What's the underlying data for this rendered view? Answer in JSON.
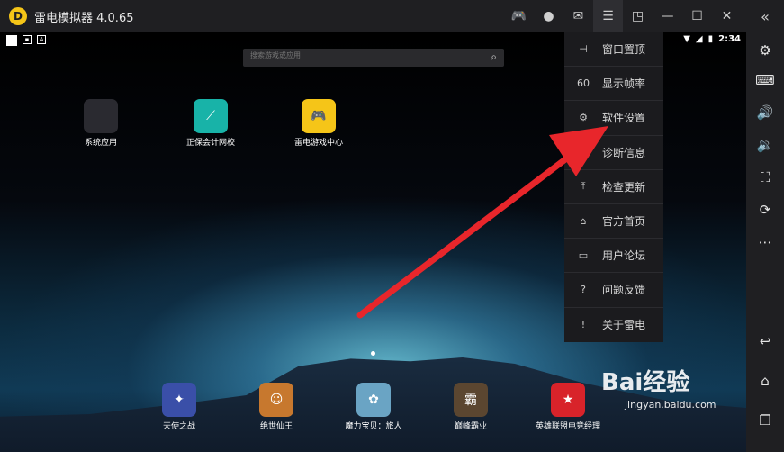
{
  "titlebar": {
    "title": "雷电模拟器 4.0.65",
    "logo_text": "D",
    "icons": [
      "gamepad-icon",
      "user-icon",
      "mail-icon",
      "menu-icon",
      "resize-icon",
      "minimize-icon",
      "maximize-icon",
      "close-icon"
    ],
    "collapse_icon": "«"
  },
  "statusbar": {
    "time": "2:34",
    "left_icons": [
      "square-icon",
      "image-icon",
      "a-icon"
    ],
    "right_icons": [
      "wifi-icon",
      "signal-icon",
      "battery-icon"
    ]
  },
  "search": {
    "placeholder": "搜索游戏或应用"
  },
  "apps_top": [
    {
      "label": "系统应用",
      "icon": "folder-icon",
      "color": "#2a2a30"
    },
    {
      "label": "正保会计网校",
      "icon": "zhengbao-icon",
      "color": "#18b3a8"
    },
    {
      "label": "雷电游戏中心",
      "icon": "game-center-icon",
      "color": "#f5c518"
    }
  ],
  "apps_bottom": [
    {
      "label": "天使之战",
      "icon": "angel-war-icon",
      "color": "#3a4fa8"
    },
    {
      "label": "绝世仙王",
      "icon": "xianwang-icon",
      "color": "#c7782e"
    },
    {
      "label": "魔力宝贝：旅人",
      "icon": "molibaobei-icon",
      "color": "#6aa4c4"
    },
    {
      "label": "巅峰霸业",
      "icon": "dianfeng-icon",
      "color": "#5b4630"
    },
    {
      "label": "英雄联盟电竞经理",
      "icon": "lol-manager-icon",
      "color": "#d8232a"
    }
  ],
  "menu": {
    "items": [
      {
        "label": "窗口置顶",
        "icon": "pin-icon",
        "glyph": "⊣"
      },
      {
        "label": "显示帧率",
        "icon": "fps-icon",
        "glyph": "60"
      },
      {
        "label": "软件设置",
        "icon": "gear-icon",
        "glyph": "⚙"
      },
      {
        "label": "诊断信息",
        "icon": "diagnose-icon",
        "glyph": "⧗"
      },
      {
        "label": "检查更新",
        "icon": "upload-icon",
        "glyph": "⤒"
      },
      {
        "label": "官方首页",
        "icon": "home-icon",
        "glyph": "⌂"
      },
      {
        "label": "用户论坛",
        "icon": "forum-icon",
        "glyph": "▭"
      },
      {
        "label": "问题反馈",
        "icon": "question-icon",
        "glyph": "?"
      },
      {
        "label": "关于雷电",
        "icon": "info-icon",
        "glyph": "!"
      }
    ]
  },
  "sidebar": {
    "buttons": [
      {
        "name": "settings-gear",
        "glyph": "⚙"
      },
      {
        "name": "keyboard",
        "glyph": "⌨"
      },
      {
        "name": "volume-up",
        "glyph": "🔊"
      },
      {
        "name": "volume-down",
        "glyph": "🔉"
      },
      {
        "name": "fullscreen",
        "glyph": "⛶"
      },
      {
        "name": "rotate",
        "glyph": "⟳"
      },
      {
        "name": "more",
        "glyph": "⋯"
      },
      {
        "name": "back",
        "glyph": "↩"
      },
      {
        "name": "home",
        "glyph": "⌂"
      },
      {
        "name": "recent",
        "glyph": "❐"
      }
    ]
  },
  "watermark": {
    "text": "Bai经验",
    "sub": "jingyan.baidu.com"
  },
  "colors": {
    "arrow": "#e8262b",
    "titlebar": "#1f1f22",
    "menu": "#1b1b1e"
  }
}
